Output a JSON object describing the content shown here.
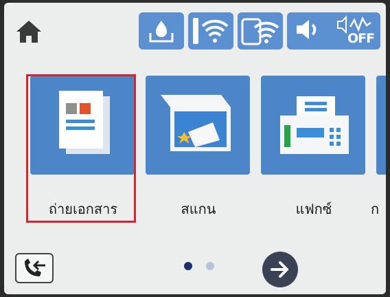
{
  "home": {
    "icon": "home-icon"
  },
  "status_bar": {
    "items": [
      {
        "icon": "ink-level-icon"
      },
      {
        "icon": "wifi-icon"
      },
      {
        "icon": "wifi-direct-icon"
      },
      {
        "icon": "sound-icon"
      },
      {
        "icon": "quiet-mode-off-icon",
        "label": "OFF"
      }
    ]
  },
  "tiles": [
    {
      "label": "ถ่ายเอกสาร",
      "icon": "copy-icon",
      "selected": true
    },
    {
      "label": "สแกน",
      "icon": "scan-icon"
    },
    {
      "label": "แฟกซ์",
      "icon": "fax-icon"
    },
    {
      "label": "ก",
      "icon": "more-icon"
    }
  ],
  "pagination": {
    "current": 1,
    "total": 2
  },
  "bottom_bar": {
    "left_icon": "phonebook-icon",
    "next_icon": "next-arrow-icon"
  },
  "colors": {
    "tile_blue": "#4a86c8",
    "status_blue": "#5b8fd0",
    "selection_red": "#d6262b",
    "screen_bg": "#eceeee",
    "next_button": "#3b4256"
  }
}
